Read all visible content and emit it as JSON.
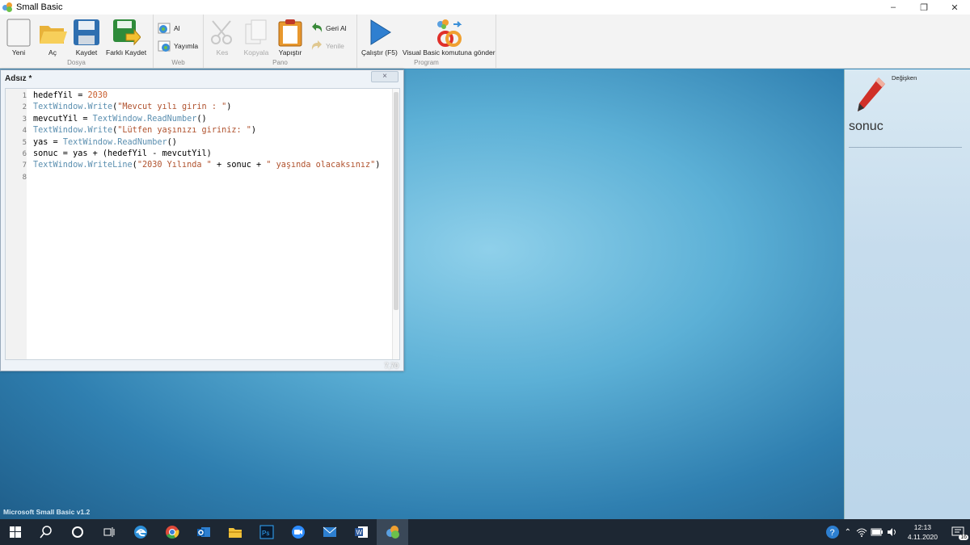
{
  "window": {
    "title": "Small Basic"
  },
  "ribbon": {
    "groups": [
      {
        "label": "Dosya",
        "tools": [
          {
            "label": "Yeni",
            "icon": "new-document-icon"
          },
          {
            "label": "Aç",
            "icon": "open-folder-icon"
          },
          {
            "label": "Kaydet",
            "icon": "save-disk-icon"
          },
          {
            "label": "Farklı Kaydet",
            "icon": "save-as-icon"
          }
        ]
      },
      {
        "label": "Web",
        "tools": [
          {
            "label": "Al",
            "icon": "import-globe-icon"
          },
          {
            "label": "Yayımla",
            "icon": "publish-globe-icon"
          }
        ]
      },
      {
        "label": "Pano",
        "tools": [
          {
            "label": "Kes",
            "icon": "scissors-icon",
            "disabled": true
          },
          {
            "label": "Kopyala",
            "icon": "copy-icon",
            "disabled": true
          },
          {
            "label": "Yapıştır",
            "icon": "clipboard-icon"
          },
          {
            "label": "Geri Al",
            "icon": "undo-icon"
          },
          {
            "label": "Yenile",
            "icon": "redo-icon",
            "disabled": true
          }
        ]
      },
      {
        "label": "Program",
        "tools": [
          {
            "label": "Çalıştır (F5)",
            "icon": "run-play-icon"
          },
          {
            "label": "Visual Basic komutuna gönder",
            "icon": "graduate-vb-icon"
          }
        ]
      }
    ]
  },
  "editor": {
    "title": "Adsız *",
    "close_label": "×",
    "cursor": "7,70",
    "lines": [
      {
        "n": "1",
        "code": "hedefYil = 2030"
      },
      {
        "n": "2",
        "code": "TextWindow.Write(\"Mevcut yılı girin : \")"
      },
      {
        "n": "3",
        "code": "mevcutYil = TextWindow.ReadNumber()"
      },
      {
        "n": "4",
        "code": "TextWindow.Write(\"Lütfen yaşınızı giriniz: \")"
      },
      {
        "n": "5",
        "code": "yas = TextWindow.ReadNumber()"
      },
      {
        "n": "6",
        "code": "sonuc = yas + (hedefYil - mevcutYil)"
      },
      {
        "n": "7",
        "code": "TextWindow.WriteLine(\"2030 Yılında \" + sonuc + \" yaşında olacaksınız\")"
      },
      {
        "n": "8",
        "code": ""
      }
    ]
  },
  "status": {
    "version": "Microsoft Small Basic v1.2"
  },
  "variables_panel": {
    "label": "Değişken",
    "icon": "pencil-icon",
    "selected": "sonuc"
  },
  "taskbar": {
    "apps": [
      "windows-start-icon",
      "search-icon",
      "cortana-icon",
      "task-view-icon",
      "edge-icon",
      "chrome-icon",
      "outlook-icon",
      "file-explorer-icon",
      "photoshop-icon",
      "zoom-icon",
      "mail-icon",
      "word-icon",
      "small-basic-icon"
    ],
    "active_app": "small-basic-icon",
    "time": "12:13",
    "date": "4.11.2020",
    "notifications": "16"
  },
  "colors": {
    "keyword": "#5b8fb0",
    "string": "#b0522e",
    "number": "#c85c2c",
    "default": "#000000"
  }
}
